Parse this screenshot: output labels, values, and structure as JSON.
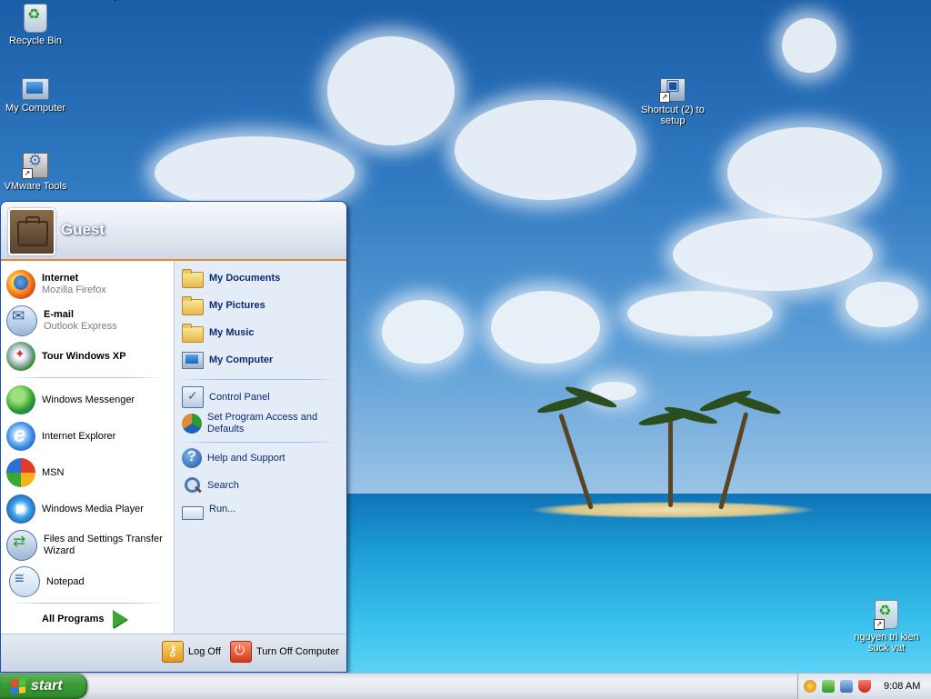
{
  "desktop": {
    "icons": [
      {
        "label": "Recycle Bin",
        "icon": "recycle-bin-icon"
      },
      {
        "label": "My Computer",
        "icon": "computer-icon"
      },
      {
        "label": "VMware Tools",
        "icon": "vmware-tools-icon"
      },
      {
        "label": "Shortcut (2) to setup",
        "icon": "network-setup-icon"
      },
      {
        "label": "nguyen tri kien suck vat",
        "icon": "recycle-shortcut-icon"
      }
    ]
  },
  "start_menu": {
    "user_name": "Guest",
    "pinned": [
      {
        "title": "Internet",
        "subtitle": "Mozilla Firefox",
        "icon": "firefox-icon"
      },
      {
        "title": "E-mail",
        "subtitle": "Outlook Express",
        "icon": "email-icon"
      }
    ],
    "recent": [
      {
        "label": "Tour Windows XP",
        "icon": "tour-icon"
      },
      {
        "label": "Windows Messenger",
        "icon": "messenger-icon"
      },
      {
        "label": "Internet Explorer",
        "icon": "internet-explorer-icon"
      },
      {
        "label": "MSN",
        "icon": "msn-icon"
      },
      {
        "label": "Windows Media Player",
        "icon": "media-player-icon"
      },
      {
        "label": "Files and Settings Transfer Wizard",
        "icon": "transfer-wizard-icon"
      },
      {
        "label": "Notepad",
        "icon": "notepad-icon"
      }
    ],
    "all_programs_label": "All Programs",
    "places": [
      {
        "label": "My Documents",
        "icon": "folder-icon"
      },
      {
        "label": "My Pictures",
        "icon": "folder-icon"
      },
      {
        "label": "My Music",
        "icon": "folder-icon"
      },
      {
        "label": "My Computer",
        "icon": "computer-icon"
      }
    ],
    "settings": [
      {
        "label": "Control Panel",
        "icon": "control-panel-icon"
      },
      {
        "label": "Set Program Access and Defaults",
        "icon": "program-access-icon"
      }
    ],
    "tools": [
      {
        "label": "Help and Support",
        "icon": "help-icon"
      },
      {
        "label": "Search",
        "icon": "search-icon"
      },
      {
        "label": "Run...",
        "icon": "run-icon"
      }
    ],
    "footer": {
      "log_off_label": "Log Off",
      "turn_off_label": "Turn Off Computer"
    }
  },
  "taskbar": {
    "start_label": "start",
    "clock": "9:08 AM",
    "tray_icons": [
      "tray-status-icon",
      "tray-network-icon",
      "tray-vmware-icon",
      "tray-security-shield-icon"
    ]
  },
  "colors": {
    "menu_border": "#1b4fb5",
    "menu_right_pane": "#e4ecf7",
    "header_accent": "#e08a3c",
    "start_button": "#3a9a36",
    "places_text": "#0c2a74"
  }
}
